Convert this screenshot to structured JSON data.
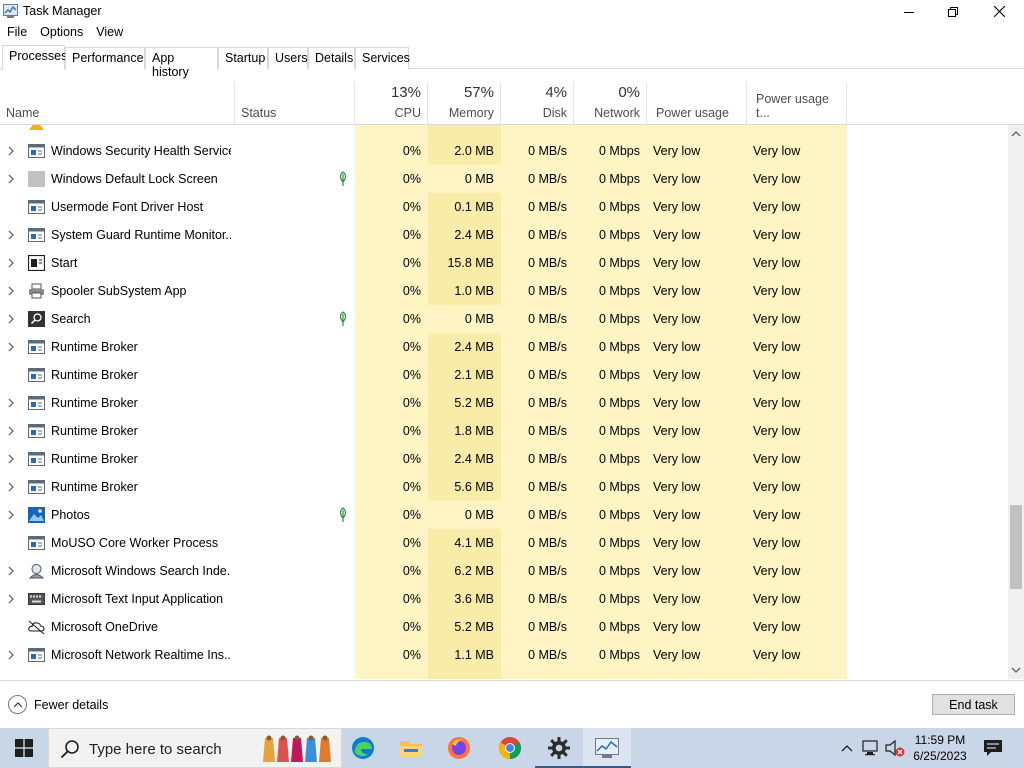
{
  "window": {
    "title": "Task Manager"
  },
  "menu": [
    "File",
    "Options",
    "View"
  ],
  "tabs": [
    "Processes",
    "Performance",
    "App history",
    "Startup",
    "Users",
    "Details",
    "Services"
  ],
  "active_tab": "Processes",
  "columns": {
    "name": "Name",
    "status": "Status",
    "cpu": {
      "label": "CPU",
      "total": "13%"
    },
    "memory": {
      "label": "Memory",
      "total": "57%"
    },
    "disk": {
      "label": "Disk",
      "total": "4%"
    },
    "network": {
      "label": "Network",
      "total": "0%"
    },
    "power": "Power usage",
    "power_trend": "Power usage t..."
  },
  "rows": [
    {
      "name": "Windows Security Health Service",
      "icon": "service-window-icon",
      "expandable": true,
      "suspended": false,
      "cpu": "0%",
      "memory": "2.0 MB",
      "disk": "0 MB/s",
      "network": "0 Mbps",
      "power": "Very low",
      "power_trend": "Very low"
    },
    {
      "name": "Windows Default Lock Screen",
      "icon": "gray-square-icon",
      "expandable": true,
      "suspended": true,
      "cpu": "0%",
      "memory": "0 MB",
      "disk": "0 MB/s",
      "network": "0 Mbps",
      "power": "Very low",
      "power_trend": "Very low"
    },
    {
      "name": "Usermode Font Driver Host",
      "icon": "service-window-icon",
      "expandable": false,
      "suspended": false,
      "cpu": "0%",
      "memory": "0.1 MB",
      "disk": "0 MB/s",
      "network": "0 Mbps",
      "power": "Very low",
      "power_trend": "Very low"
    },
    {
      "name": "System Guard Runtime Monitor...",
      "icon": "service-window-icon",
      "expandable": true,
      "suspended": false,
      "cpu": "0%",
      "memory": "2.4 MB",
      "disk": "0 MB/s",
      "network": "0 Mbps",
      "power": "Very low",
      "power_trend": "Very low"
    },
    {
      "name": "Start",
      "icon": "start-window-icon",
      "expandable": true,
      "suspended": false,
      "cpu": "0%",
      "memory": "15.8 MB",
      "disk": "0 MB/s",
      "network": "0 Mbps",
      "power": "Very low",
      "power_trend": "Very low"
    },
    {
      "name": "Spooler SubSystem App",
      "icon": "printer-icon",
      "expandable": true,
      "suspended": false,
      "cpu": "0%",
      "memory": "1.0 MB",
      "disk": "0 MB/s",
      "network": "0 Mbps",
      "power": "Very low",
      "power_trend": "Very low"
    },
    {
      "name": "Search",
      "icon": "search-app-icon",
      "expandable": true,
      "suspended": true,
      "cpu": "0%",
      "memory": "0 MB",
      "disk": "0 MB/s",
      "network": "0 Mbps",
      "power": "Very low",
      "power_trend": "Very low"
    },
    {
      "name": "Runtime Broker",
      "icon": "service-window-icon",
      "expandable": true,
      "suspended": false,
      "cpu": "0%",
      "memory": "2.4 MB",
      "disk": "0 MB/s",
      "network": "0 Mbps",
      "power": "Very low",
      "power_trend": "Very low"
    },
    {
      "name": "Runtime Broker",
      "icon": "service-window-icon",
      "expandable": false,
      "suspended": false,
      "cpu": "0%",
      "memory": "2.1 MB",
      "disk": "0 MB/s",
      "network": "0 Mbps",
      "power": "Very low",
      "power_trend": "Very low"
    },
    {
      "name": "Runtime Broker",
      "icon": "service-window-icon",
      "expandable": true,
      "suspended": false,
      "cpu": "0%",
      "memory": "5.2 MB",
      "disk": "0 MB/s",
      "network": "0 Mbps",
      "power": "Very low",
      "power_trend": "Very low"
    },
    {
      "name": "Runtime Broker",
      "icon": "service-window-icon",
      "expandable": true,
      "suspended": false,
      "cpu": "0%",
      "memory": "1.8 MB",
      "disk": "0 MB/s",
      "network": "0 Mbps",
      "power": "Very low",
      "power_trend": "Very low"
    },
    {
      "name": "Runtime Broker",
      "icon": "service-window-icon",
      "expandable": true,
      "suspended": false,
      "cpu": "0%",
      "memory": "2.4 MB",
      "disk": "0 MB/s",
      "network": "0 Mbps",
      "power": "Very low",
      "power_trend": "Very low"
    },
    {
      "name": "Runtime Broker",
      "icon": "service-window-icon",
      "expandable": true,
      "suspended": false,
      "cpu": "0%",
      "memory": "5.6 MB",
      "disk": "0 MB/s",
      "network": "0 Mbps",
      "power": "Very low",
      "power_trend": "Very low"
    },
    {
      "name": "Photos",
      "icon": "photos-icon",
      "expandable": true,
      "suspended": true,
      "cpu": "0%",
      "memory": "0 MB",
      "disk": "0 MB/s",
      "network": "0 Mbps",
      "power": "Very low",
      "power_trend": "Very low"
    },
    {
      "name": "MoUSO Core Worker Process",
      "icon": "service-window-icon",
      "expandable": false,
      "suspended": false,
      "cpu": "0%",
      "memory": "4.1 MB",
      "disk": "0 MB/s",
      "network": "0 Mbps",
      "power": "Very low",
      "power_trend": "Very low"
    },
    {
      "name": "Microsoft Windows Search Inde...",
      "icon": "search-indexer-icon",
      "expandable": true,
      "suspended": false,
      "cpu": "0%",
      "memory": "6.2 MB",
      "disk": "0 MB/s",
      "network": "0 Mbps",
      "power": "Very low",
      "power_trend": "Very low"
    },
    {
      "name": "Microsoft Text Input Application",
      "icon": "keyboard-icon",
      "expandable": true,
      "suspended": false,
      "cpu": "0%",
      "memory": "3.6 MB",
      "disk": "0 MB/s",
      "network": "0 Mbps",
      "power": "Very low",
      "power_trend": "Very low"
    },
    {
      "name": "Microsoft OneDrive",
      "icon": "onedrive-icon",
      "expandable": false,
      "suspended": false,
      "cpu": "0%",
      "memory": "5.2 MB",
      "disk": "0 MB/s",
      "network": "0 Mbps",
      "power": "Very low",
      "power_trend": "Very low"
    },
    {
      "name": "Microsoft Network Realtime Ins...",
      "icon": "service-window-icon",
      "expandable": true,
      "suspended": false,
      "cpu": "0%",
      "memory": "1.1 MB",
      "disk": "0 MB/s",
      "network": "0 Mbps",
      "power": "Very low",
      "power_trend": "Very low"
    }
  ],
  "bottom": {
    "fewer_details": "Fewer details",
    "end_task": "End task"
  },
  "taskbar": {
    "search_placeholder": "Type here to search",
    "time": "11:59 PM",
    "date": "6/25/2023"
  },
  "colors": {
    "heat_light": "#fff4c4",
    "heat_medium": "#f9eca8",
    "taskbar": "#c9d6e7",
    "accent": "#3a5a8c"
  }
}
